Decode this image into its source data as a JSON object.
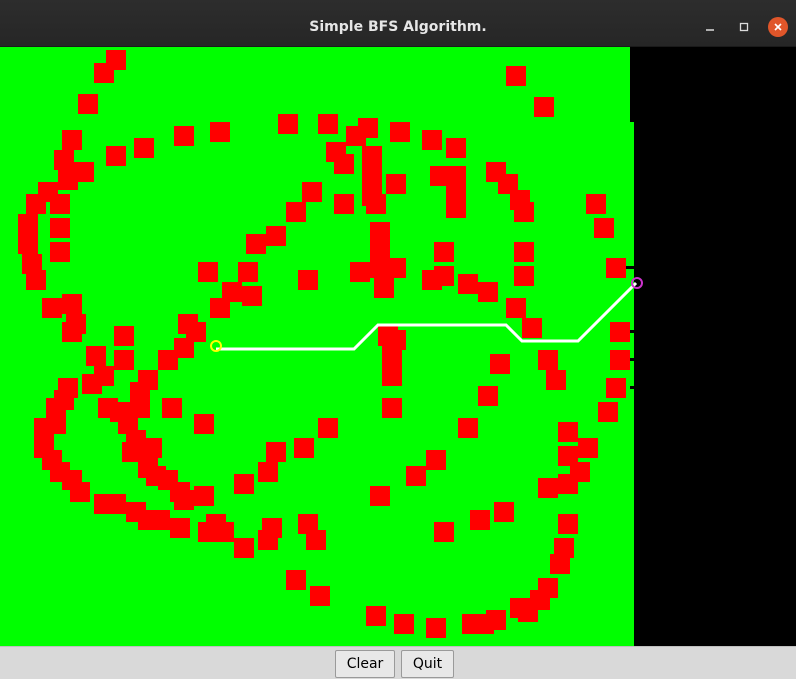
{
  "window": {
    "title": "Simple BFS Algorithm.",
    "controls": [
      "minimize-icon",
      "maximize-icon",
      "close-icon"
    ]
  },
  "buttons": {
    "clear_label": "Clear",
    "quit_label": "Quit"
  },
  "colors": {
    "field": "#00ff00",
    "obstacle": "#ff0000",
    "path": "#ffffff",
    "start_marker": "#ffff00",
    "goal_marker": "#cc33cc",
    "background": "#000000"
  }
}
